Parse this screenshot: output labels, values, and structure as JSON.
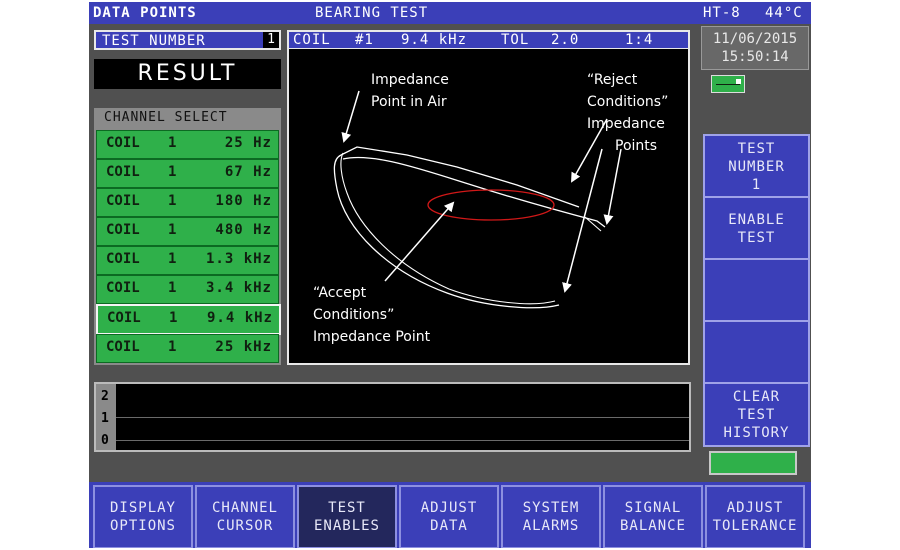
{
  "topbar": {
    "left": "DATA POINTS",
    "center": "BEARING TEST",
    "model": "HT-8",
    "temp": "44°C"
  },
  "test_number": {
    "label": "TEST NUMBER",
    "value": "1"
  },
  "result_label": "RESULT",
  "channel_select": {
    "title": "CHANNEL SELECT",
    "items": [
      {
        "coil": "COIL",
        "num": "1",
        "freq": "25  Hz"
      },
      {
        "coil": "COIL",
        "num": "1",
        "freq": "67  Hz"
      },
      {
        "coil": "COIL",
        "num": "1",
        "freq": "180  Hz"
      },
      {
        "coil": "COIL",
        "num": "1",
        "freq": "480  Hz"
      },
      {
        "coil": "COIL",
        "num": "1",
        "freq": "1.3 kHz"
      },
      {
        "coil": "COIL",
        "num": "1",
        "freq": "3.4 kHz"
      },
      {
        "coil": "COIL",
        "num": "1",
        "freq": "9.4 kHz",
        "selected": true
      },
      {
        "coil": "COIL",
        "num": "1",
        "freq": "25 kHz"
      }
    ]
  },
  "plot_header": {
    "coil": "COIL",
    "coil_num": "#1",
    "freq": "9.4 kHz",
    "tol_label": "TOL",
    "tol_value": "2.0",
    "scale": "1:4"
  },
  "plot_annotations": {
    "air_line1": "Impedance",
    "air_line2": "Point  in Air",
    "reject_line1": "“Reject",
    "reject_line2": "Conditions”",
    "reject_line3": "Impedance",
    "reject_line4": "Points",
    "accept_line1": "“Accept",
    "accept_line2": "Conditions”",
    "accept_line3": "Impedance Point"
  },
  "datetime": {
    "date": "11/06/2015",
    "time": "15:50:14"
  },
  "right_buttons": [
    {
      "lines": [
        "TEST",
        "NUMBER",
        "1"
      ]
    },
    {
      "lines": [
        "ENABLE",
        "TEST"
      ]
    },
    {
      "lines": []
    },
    {
      "lines": []
    },
    {
      "lines": [
        "CLEAR",
        "TEST",
        "HISTORY"
      ]
    }
  ],
  "history": {
    "ticks": [
      "2",
      "1",
      "0"
    ]
  },
  "bottom_buttons": [
    {
      "lines": [
        "DISPLAY",
        "OPTIONS"
      ]
    },
    {
      "lines": [
        "CHANNEL",
        "CURSOR"
      ]
    },
    {
      "lines": [
        "TEST",
        "ENABLES"
      ],
      "active": true
    },
    {
      "lines": [
        "ADJUST",
        "DATA"
      ]
    },
    {
      "lines": [
        "SYSTEM",
        "ALARMS"
      ]
    },
    {
      "lines": [
        "SIGNAL",
        "BALANCE"
      ]
    },
    {
      "lines": [
        "ADJUST",
        "TOLERANCE"
      ]
    }
  ],
  "colors": {
    "panel_blue": "#3b3fb8",
    "channel_green": "#2fb04a",
    "accept_ellipse": "#d01818"
  }
}
